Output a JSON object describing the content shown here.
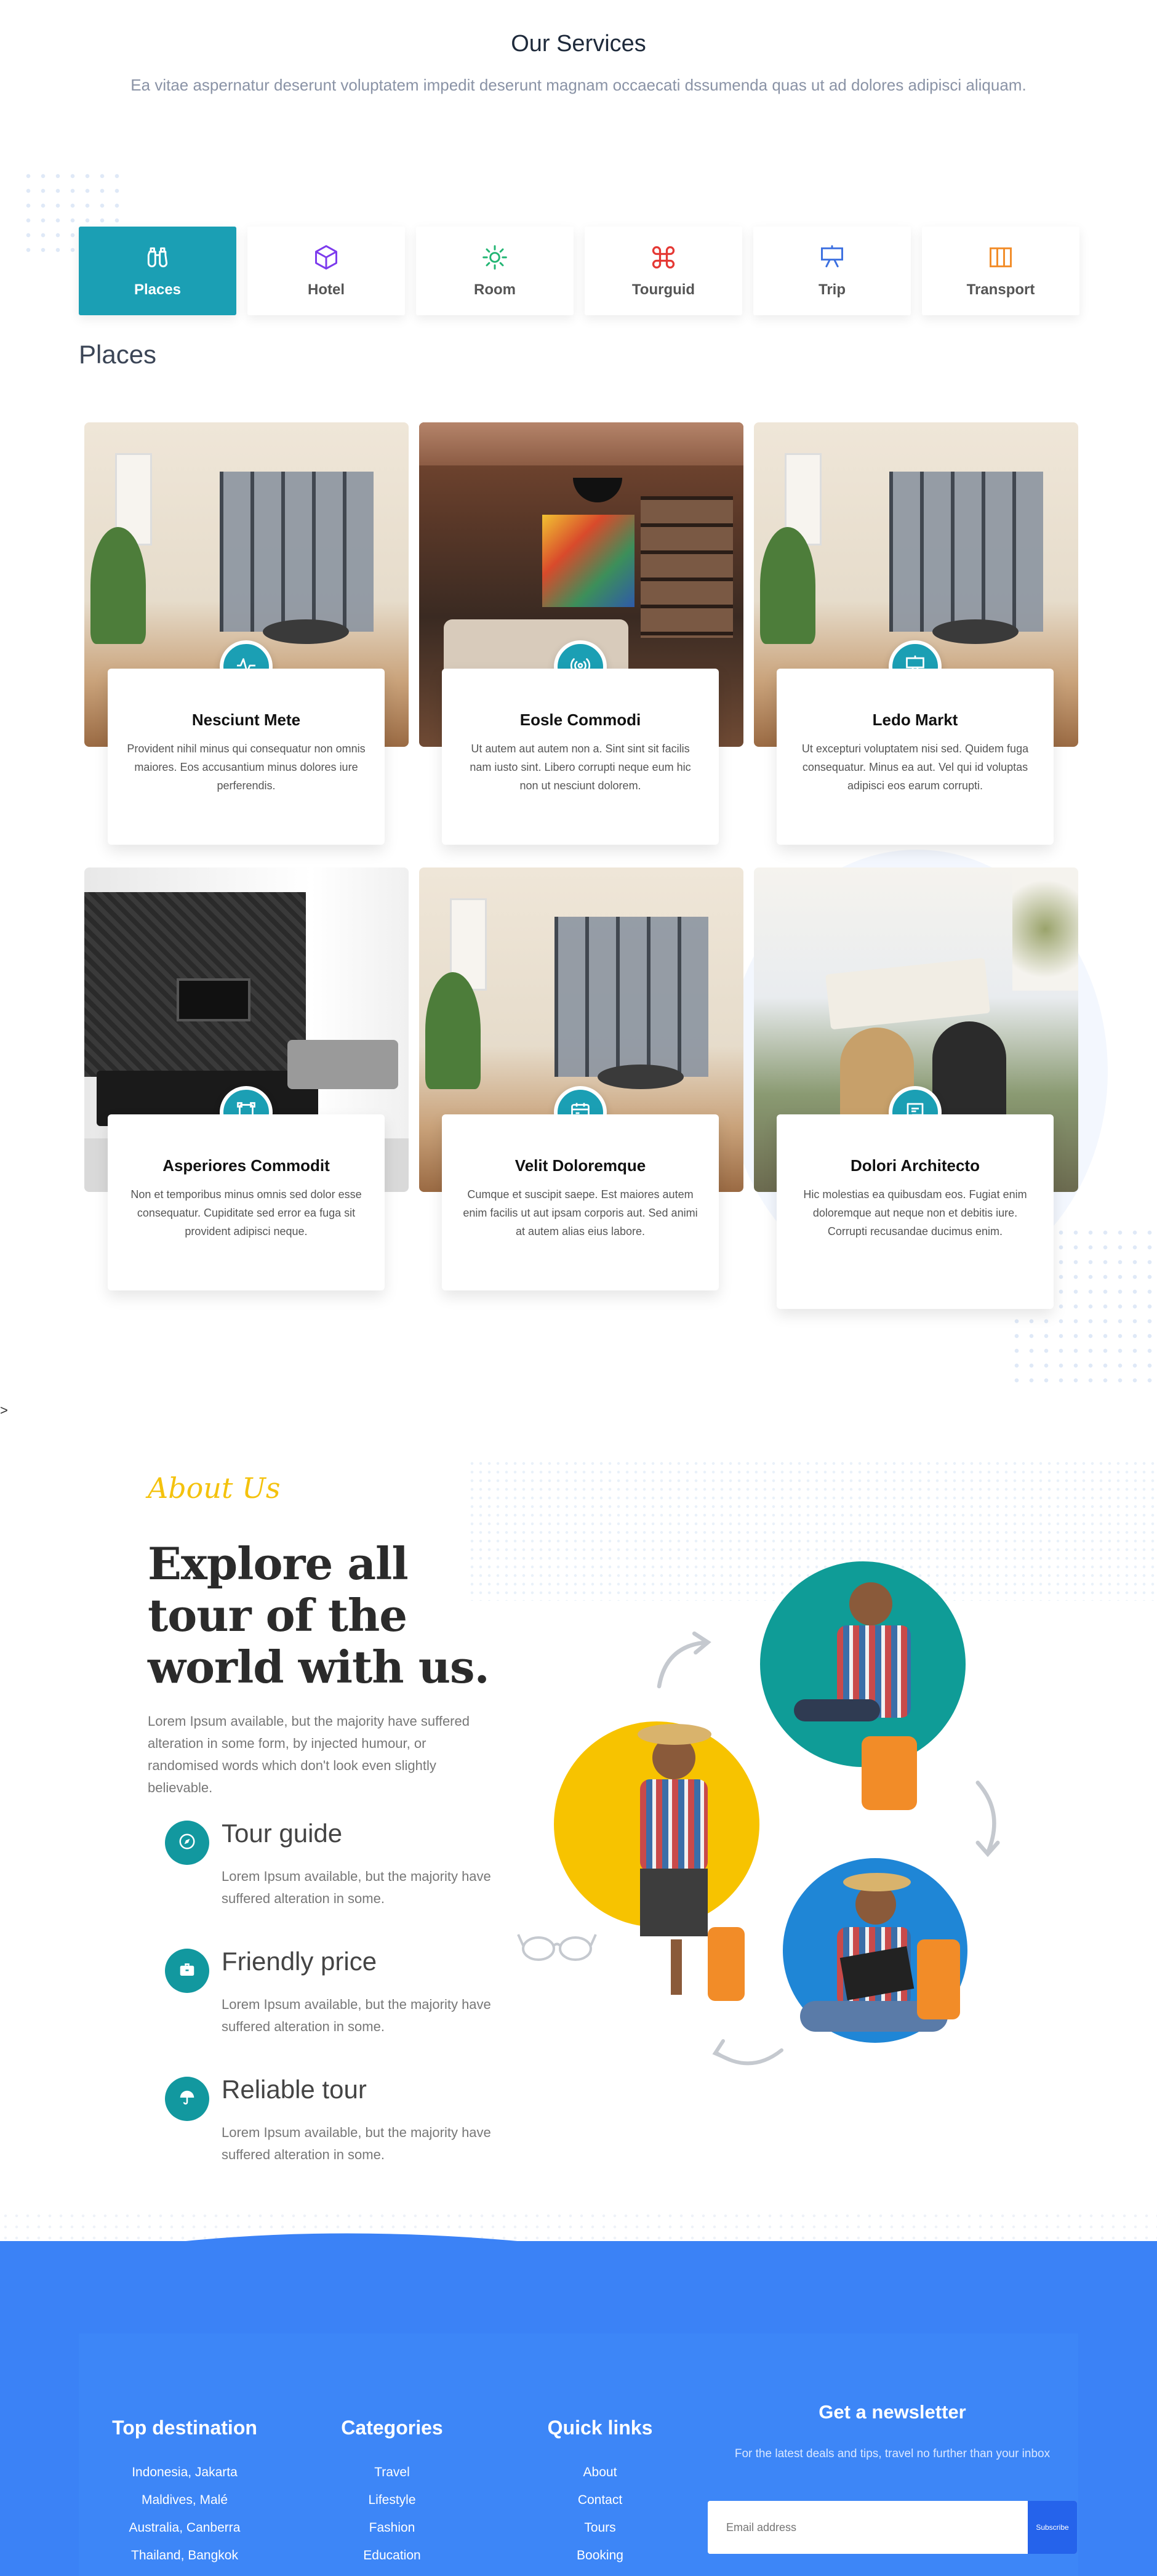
{
  "services": {
    "title": "Our Services",
    "subtitle": "Ea vitae aspernatur deserunt voluptatem impedit deserunt magnam occaecati dssumenda quas ut ad dolores adipisci aliquam."
  },
  "tabs": [
    {
      "label": "Places",
      "icon": "binoculars-icon",
      "color": "#ffffff",
      "active": true
    },
    {
      "label": "Hotel",
      "icon": "box-icon",
      "color": "#7c3aed"
    },
    {
      "label": "Room",
      "icon": "sun-icon",
      "color": "#22b573"
    },
    {
      "label": "Tourguid",
      "icon": "command-icon",
      "color": "#e53935"
    },
    {
      "label": "Trip",
      "icon": "easel-icon",
      "color": "#3b6fe0"
    },
    {
      "label": "Transport",
      "icon": "columns-icon",
      "color": "#f28c28"
    }
  ],
  "places": {
    "heading": "Places",
    "cards": [
      {
        "title": "Nesciunt Mete",
        "desc": "Provident nihil minus qui consequatur non omnis maiores. Eos accusantium minus dolores iure perferendis.",
        "icon": "activity-icon",
        "image": "living-room-bookshelf"
      },
      {
        "title": "Eosle Commodi",
        "desc": "Ut autem aut autem non a. Sint sint sit facilis nam iusto sint. Libero corrupti neque eum hic non ut nesciunt dolorem.",
        "icon": "broadcast-icon",
        "image": "cozy-lounge"
      },
      {
        "title": "Ledo Markt",
        "desc": "Ut excepturi voluptatem nisi sed. Quidem fuga consequatur. Minus ea aut. Vel qui id voluptas adipisci eos earum corrupti.",
        "icon": "easel-icon",
        "image": "living-room-bookshelf"
      },
      {
        "title": "Asperiores Commodit",
        "desc": "Non et temporibus minus omnis sed dolor esse consequatur. Cupiditate sed error ea fuga sit provident adipisci neque.",
        "icon": "bounding-box-icon",
        "image": "modern-tv-room"
      },
      {
        "title": "Velit Doloremque",
        "desc": "Cumque et suscipit saepe. Est maiores autem enim facilis ut aut ipsam corporis aut. Sed animi at autem alias eius labore.",
        "icon": "calendar-icon",
        "image": "living-room-bookshelf"
      },
      {
        "title": "Dolori Architecto",
        "desc": "Hic molestias ea quibusdam eos. Fugiat enim doloremque aut neque non et debitis iure. Corrupti recusandae ducimus enim.",
        "icon": "chat-icon",
        "image": "friends-cliff"
      }
    ]
  },
  "stray_mark": ">",
  "about": {
    "script_label": "About Us",
    "heading": "Explore all tour of the world with us.",
    "paragraph": "Lorem Ipsum available, but the majority have suffered alteration in some form, by injected humour, or randomised words which don't look even slightly believable.",
    "features": [
      {
        "title": "Tour guide",
        "desc": "Lorem Ipsum available, but the majority have suffered alteration in some.",
        "icon": "compass-icon"
      },
      {
        "title": "Friendly price",
        "desc": "Lorem Ipsum available, but the majority have suffered alteration in some.",
        "icon": "briefcase-icon"
      },
      {
        "title": "Reliable tour",
        "desc": "Lorem Ipsum available, but the majority have suffered alteration in some.",
        "icon": "umbrella-icon"
      }
    ],
    "circle_colors": [
      "#0f9c97",
      "#f7c300",
      "#1f86d6"
    ]
  },
  "footer": {
    "background": "#3b82f6",
    "columns": [
      {
        "title": "Top destination",
        "links": [
          "Indonesia, Jakarta",
          "Maldives, Malé",
          "Australia, Canberra",
          "Thailand, Bangkok"
        ]
      },
      {
        "title": "Categories",
        "links": [
          "Travel",
          "Lifestyle",
          "Fashion",
          "Education"
        ]
      },
      {
        "title": "Quick links",
        "links": [
          "About",
          "Contact",
          "Tours",
          "Booking"
        ]
      }
    ],
    "newsletter": {
      "title": "Get a newsletter",
      "text": "For the latest deals and tips, travel no further than your inbox",
      "placeholder": "Email address",
      "button": "Subscribe"
    }
  }
}
